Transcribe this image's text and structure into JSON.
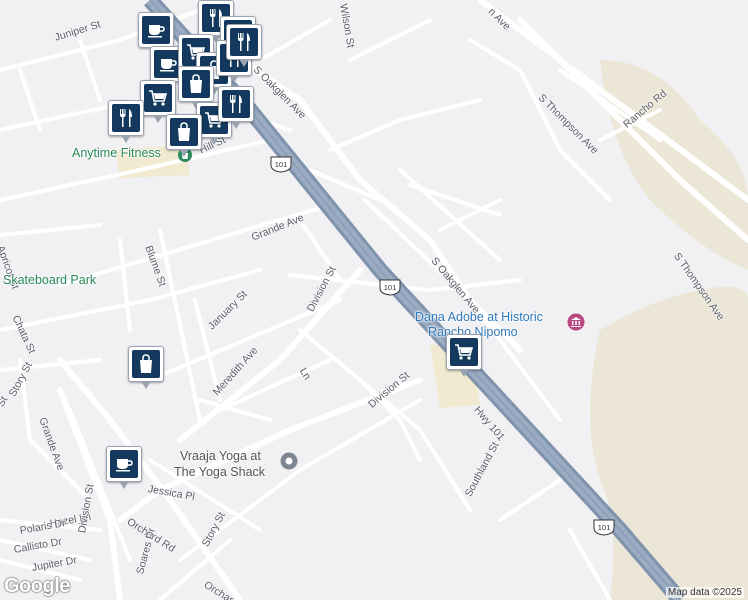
{
  "map": {
    "streets": [
      {
        "key": "juniper",
        "label": "Juniper St"
      },
      {
        "key": "wilson",
        "label": "Wilson St"
      },
      {
        "key": "oakglen_n",
        "label": "S Oakglen Ave"
      },
      {
        "key": "thompson_n",
        "label": "S Thompson Ave"
      },
      {
        "key": "thompson_s",
        "label": "S Thompson Ave"
      },
      {
        "key": "rancho",
        "label": "Rancho Rd"
      },
      {
        "key": "hill",
        "label": "Hill St"
      },
      {
        "key": "grande",
        "label": "Grande Ave"
      },
      {
        "key": "blume",
        "label": "Blume St"
      },
      {
        "key": "oakglen_s",
        "label": "S Oakglen Ave"
      },
      {
        "key": "division_n",
        "label": "Division St"
      },
      {
        "key": "january",
        "label": "January St"
      },
      {
        "key": "chata",
        "label": "Chata St"
      },
      {
        "key": "ln",
        "label": "Ln"
      },
      {
        "key": "meredith",
        "label": "Meredith Ave"
      },
      {
        "key": "division_s",
        "label": "Division St"
      },
      {
        "key": "story_n",
        "label": "Story St"
      },
      {
        "key": "grande_w",
        "label": "Grande Ave"
      },
      {
        "key": "apricot",
        "label": "Apricot St"
      },
      {
        "key": "hwy101",
        "label": "Hwy 101"
      },
      {
        "key": "southland",
        "label": "Southland St"
      },
      {
        "key": "jessica",
        "label": "Jessica Pl"
      },
      {
        "key": "hazel",
        "label": "Hazel Ln"
      },
      {
        "key": "polaris",
        "label": "Polaris Dr"
      },
      {
        "key": "callisto",
        "label": "Callisto Dr"
      },
      {
        "key": "jupiter",
        "label": "Jupiter Dr"
      },
      {
        "key": "orchard_1",
        "label": "Orchard Rd"
      },
      {
        "key": "orchard_2",
        "label": "Orchar"
      },
      {
        "key": "division_sw",
        "label": "Division St"
      },
      {
        "key": "soares",
        "label": "Soares Dr"
      },
      {
        "key": "story_s",
        "label": "Story St"
      },
      {
        "key": "st_edge",
        "label": "St"
      },
      {
        "key": "e_ave",
        "label": "n Ave"
      }
    ],
    "pois": {
      "anytime": "Anytime Fitness",
      "skate": "Skateboard Park",
      "dana_1": "Dana Adobe at Historic",
      "dana_2": "Rancho Nipomo",
      "yoga_1": "Vraaja Yoga at",
      "yoga_2": "The Yoga Shack"
    },
    "shields": [
      "101",
      "101",
      "101"
    ],
    "markers": [
      {
        "icon": "coffee"
      },
      {
        "icon": "restaurant"
      },
      {
        "icon": "shopping"
      },
      {
        "icon": "coffee"
      },
      {
        "icon": "grocery"
      },
      {
        "icon": "shopping"
      },
      {
        "icon": "restaurant"
      },
      {
        "icon": "restaurant"
      },
      {
        "icon": "grocery"
      },
      {
        "icon": "restaurant"
      },
      {
        "icon": "shopping"
      },
      {
        "icon": "grocery"
      },
      {
        "icon": "restaurant"
      },
      {
        "icon": "shopping"
      },
      {
        "icon": "shopping"
      },
      {
        "icon": "grocery"
      },
      {
        "icon": "coffee"
      }
    ],
    "colors": {
      "background": "#f1f0f3",
      "highway": "#8a9cb5",
      "road": "#ffffff",
      "marker": "#133a5e",
      "park_label": "#2a8a5a",
      "poi_label": "#2f79b9"
    },
    "attribution": "Map data ©2025",
    "logo": "Google"
  }
}
